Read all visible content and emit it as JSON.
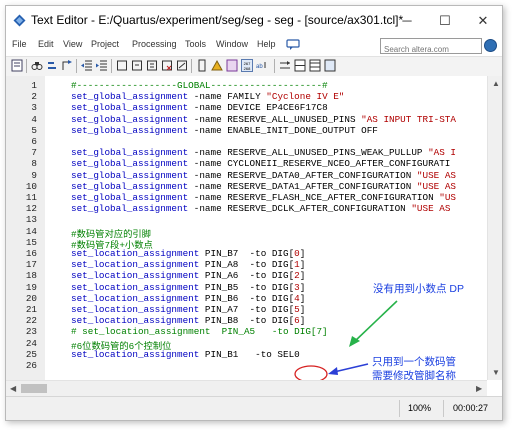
{
  "window": {
    "title": "Text Editor - E:/Quartus/experiment/seg/seg - seg - [source/ax301.tcl]*",
    "minimize": "─",
    "maximize": "☐",
    "close": "✕"
  },
  "menubar": {
    "items": [
      "File",
      "Edit",
      "View",
      "Project",
      "Processing",
      "Tools",
      "Window",
      "Help"
    ],
    "search_placeholder": "Search altera.com"
  },
  "editor": {
    "line_numbers": [
      "1",
      "2",
      "3",
      "4",
      "5",
      "6",
      "7",
      "8",
      "9",
      "10",
      "11",
      "12",
      "13",
      "14",
      "15",
      "16",
      "17",
      "18",
      "19",
      "20",
      "21",
      "22",
      "23",
      "24",
      "25",
      "26"
    ],
    "lines": [
      [
        {
          "c": "cm",
          "t": "#------------------GLOBAL--------------------#"
        }
      ],
      [
        {
          "c": "kw",
          "t": "set_global_assignment"
        },
        {
          "c": "",
          "t": " -name FAMILY "
        },
        {
          "c": "str",
          "t": "\"Cyclone IV E\""
        }
      ],
      [
        {
          "c": "kw",
          "t": "set_global_assignment"
        },
        {
          "c": "",
          "t": " -name DEVICE EP4CE6F17C8"
        }
      ],
      [
        {
          "c": "kw",
          "t": "set_global_assignment"
        },
        {
          "c": "",
          "t": " -name RESERVE_ALL_UNUSED_PINS "
        },
        {
          "c": "str",
          "t": "\"AS INPUT TRI-STA"
        }
      ],
      [
        {
          "c": "kw",
          "t": "set_global_assignment"
        },
        {
          "c": "",
          "t": " -name ENABLE_INIT_DONE_OUTPUT OFF"
        }
      ],
      [],
      [
        {
          "c": "kw",
          "t": "set_global_assignment"
        },
        {
          "c": "",
          "t": " -name RESERVE_ALL_UNUSED_PINS_WEAK_PULLUP "
        },
        {
          "c": "str",
          "t": "\"AS I"
        }
      ],
      [
        {
          "c": "kw",
          "t": "set_global_assignment"
        },
        {
          "c": "",
          "t": " -name CYCLONEII_RESERVE_NCEO_AFTER_CONFIGURATI"
        }
      ],
      [
        {
          "c": "kw",
          "t": "set_global_assignment"
        },
        {
          "c": "",
          "t": " -name RESERVE_DATA0_AFTER_CONFIGURATION "
        },
        {
          "c": "str",
          "t": "\"USE AS"
        }
      ],
      [
        {
          "c": "kw",
          "t": "set_global_assignment"
        },
        {
          "c": "",
          "t": " -name RESERVE_DATA1_AFTER_CONFIGURATION "
        },
        {
          "c": "str",
          "t": "\"USE AS"
        }
      ],
      [
        {
          "c": "kw",
          "t": "set_global_assignment"
        },
        {
          "c": "",
          "t": " -name RESERVE_FLASH_NCE_AFTER_CONFIGURATION "
        },
        {
          "c": "str",
          "t": "\"US"
        }
      ],
      [
        {
          "c": "kw",
          "t": "set_global_assignment"
        },
        {
          "c": "",
          "t": " -name RESERVE_DCLK_AFTER_CONFIGURATION "
        },
        {
          "c": "str",
          "t": "\"USE AS"
        }
      ],
      [],
      [
        {
          "c": "cm",
          "t": "#数码管对应的引脚"
        }
      ],
      [
        {
          "c": "cm",
          "t": "#数码管7段+小数点"
        }
      ],
      [
        {
          "c": "kw",
          "t": "set_location_assignment"
        },
        {
          "c": "",
          "t": " PIN_B7  -to DIG["
        },
        {
          "c": "str",
          "t": "0"
        },
        {
          "c": "",
          "t": "]"
        }
      ],
      [
        {
          "c": "kw",
          "t": "set_location_assignment"
        },
        {
          "c": "",
          "t": " PIN_A8  -to DIG["
        },
        {
          "c": "str",
          "t": "1"
        },
        {
          "c": "",
          "t": "]"
        }
      ],
      [
        {
          "c": "kw",
          "t": "set_location_assignment"
        },
        {
          "c": "",
          "t": " PIN_A6  -to DIG["
        },
        {
          "c": "str",
          "t": "2"
        },
        {
          "c": "",
          "t": "]"
        }
      ],
      [
        {
          "c": "kw",
          "t": "set_location_assignment"
        },
        {
          "c": "",
          "t": " PIN_B5  -to DIG["
        },
        {
          "c": "str",
          "t": "3"
        },
        {
          "c": "",
          "t": "]"
        }
      ],
      [
        {
          "c": "kw",
          "t": "set_location_assignment"
        },
        {
          "c": "",
          "t": " PIN_B6  -to DIG["
        },
        {
          "c": "str",
          "t": "4"
        },
        {
          "c": "",
          "t": "]"
        }
      ],
      [
        {
          "c": "kw",
          "t": "set_location_assignment"
        },
        {
          "c": "",
          "t": " PIN_A7  -to DIG["
        },
        {
          "c": "str",
          "t": "5"
        },
        {
          "c": "",
          "t": "]"
        }
      ],
      [
        {
          "c": "kw",
          "t": "set_location_assignment"
        },
        {
          "c": "",
          "t": " PIN_B8  -to DIG["
        },
        {
          "c": "str",
          "t": "6"
        },
        {
          "c": "",
          "t": "]"
        }
      ],
      [
        {
          "c": "cm",
          "t": "# set_location_assignment  PIN_A5   -to DIG[7]"
        }
      ],
      [
        {
          "c": "cm",
          "t": "#6位数码管的6个控制位"
        }
      ],
      [
        {
          "c": "kw",
          "t": "set_location_assignment"
        },
        {
          "c": "",
          "t": " PIN_B1   -to SEL0"
        }
      ],
      []
    ]
  },
  "annotations": {
    "no_dp": "没有用到小数点 DP",
    "one_digit_1": "只用到一个数码管",
    "one_digit_2": "需要修改管脚名称"
  },
  "colors": {
    "arrow_green": "#27b24a",
    "arrow_blue": "#2b3fd6",
    "circle_red": "#d62020"
  },
  "statusbar": {
    "zoom": "100%",
    "time": "00:00:27"
  }
}
